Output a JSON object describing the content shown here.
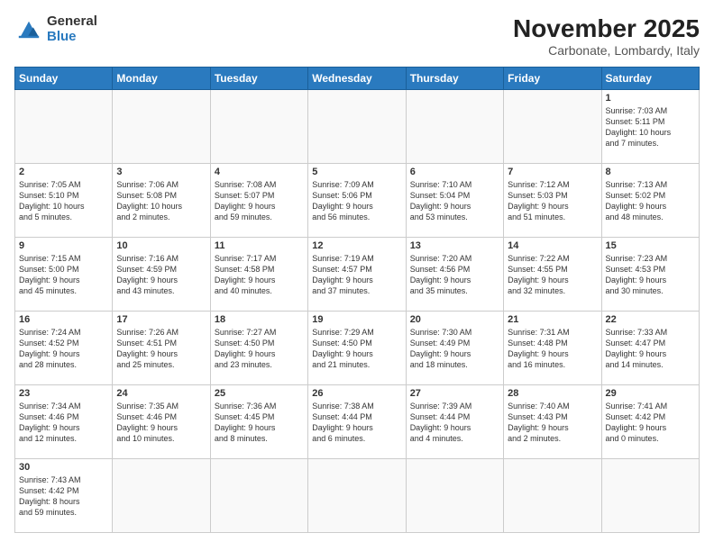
{
  "header": {
    "logo_general": "General",
    "logo_blue": "Blue",
    "month": "November 2025",
    "location": "Carbonate, Lombardy, Italy"
  },
  "weekdays": [
    "Sunday",
    "Monday",
    "Tuesday",
    "Wednesday",
    "Thursday",
    "Friday",
    "Saturday"
  ],
  "weeks": [
    [
      {
        "day": "",
        "content": ""
      },
      {
        "day": "",
        "content": ""
      },
      {
        "day": "",
        "content": ""
      },
      {
        "day": "",
        "content": ""
      },
      {
        "day": "",
        "content": ""
      },
      {
        "day": "",
        "content": ""
      },
      {
        "day": "1",
        "content": "Sunrise: 7:03 AM\nSunset: 5:11 PM\nDaylight: 10 hours\nand 7 minutes."
      }
    ],
    [
      {
        "day": "2",
        "content": "Sunrise: 7:05 AM\nSunset: 5:10 PM\nDaylight: 10 hours\nand 5 minutes."
      },
      {
        "day": "3",
        "content": "Sunrise: 7:06 AM\nSunset: 5:08 PM\nDaylight: 10 hours\nand 2 minutes."
      },
      {
        "day": "4",
        "content": "Sunrise: 7:08 AM\nSunset: 5:07 PM\nDaylight: 9 hours\nand 59 minutes."
      },
      {
        "day": "5",
        "content": "Sunrise: 7:09 AM\nSunset: 5:06 PM\nDaylight: 9 hours\nand 56 minutes."
      },
      {
        "day": "6",
        "content": "Sunrise: 7:10 AM\nSunset: 5:04 PM\nDaylight: 9 hours\nand 53 minutes."
      },
      {
        "day": "7",
        "content": "Sunrise: 7:12 AM\nSunset: 5:03 PM\nDaylight: 9 hours\nand 51 minutes."
      },
      {
        "day": "8",
        "content": "Sunrise: 7:13 AM\nSunset: 5:02 PM\nDaylight: 9 hours\nand 48 minutes."
      }
    ],
    [
      {
        "day": "9",
        "content": "Sunrise: 7:15 AM\nSunset: 5:00 PM\nDaylight: 9 hours\nand 45 minutes."
      },
      {
        "day": "10",
        "content": "Sunrise: 7:16 AM\nSunset: 4:59 PM\nDaylight: 9 hours\nand 43 minutes."
      },
      {
        "day": "11",
        "content": "Sunrise: 7:17 AM\nSunset: 4:58 PM\nDaylight: 9 hours\nand 40 minutes."
      },
      {
        "day": "12",
        "content": "Sunrise: 7:19 AM\nSunset: 4:57 PM\nDaylight: 9 hours\nand 37 minutes."
      },
      {
        "day": "13",
        "content": "Sunrise: 7:20 AM\nSunset: 4:56 PM\nDaylight: 9 hours\nand 35 minutes."
      },
      {
        "day": "14",
        "content": "Sunrise: 7:22 AM\nSunset: 4:55 PM\nDaylight: 9 hours\nand 32 minutes."
      },
      {
        "day": "15",
        "content": "Sunrise: 7:23 AM\nSunset: 4:53 PM\nDaylight: 9 hours\nand 30 minutes."
      }
    ],
    [
      {
        "day": "16",
        "content": "Sunrise: 7:24 AM\nSunset: 4:52 PM\nDaylight: 9 hours\nand 28 minutes."
      },
      {
        "day": "17",
        "content": "Sunrise: 7:26 AM\nSunset: 4:51 PM\nDaylight: 9 hours\nand 25 minutes."
      },
      {
        "day": "18",
        "content": "Sunrise: 7:27 AM\nSunset: 4:50 PM\nDaylight: 9 hours\nand 23 minutes."
      },
      {
        "day": "19",
        "content": "Sunrise: 7:29 AM\nSunset: 4:50 PM\nDaylight: 9 hours\nand 21 minutes."
      },
      {
        "day": "20",
        "content": "Sunrise: 7:30 AM\nSunset: 4:49 PM\nDaylight: 9 hours\nand 18 minutes."
      },
      {
        "day": "21",
        "content": "Sunrise: 7:31 AM\nSunset: 4:48 PM\nDaylight: 9 hours\nand 16 minutes."
      },
      {
        "day": "22",
        "content": "Sunrise: 7:33 AM\nSunset: 4:47 PM\nDaylight: 9 hours\nand 14 minutes."
      }
    ],
    [
      {
        "day": "23",
        "content": "Sunrise: 7:34 AM\nSunset: 4:46 PM\nDaylight: 9 hours\nand 12 minutes."
      },
      {
        "day": "24",
        "content": "Sunrise: 7:35 AM\nSunset: 4:46 PM\nDaylight: 9 hours\nand 10 minutes."
      },
      {
        "day": "25",
        "content": "Sunrise: 7:36 AM\nSunset: 4:45 PM\nDaylight: 9 hours\nand 8 minutes."
      },
      {
        "day": "26",
        "content": "Sunrise: 7:38 AM\nSunset: 4:44 PM\nDaylight: 9 hours\nand 6 minutes."
      },
      {
        "day": "27",
        "content": "Sunrise: 7:39 AM\nSunset: 4:44 PM\nDaylight: 9 hours\nand 4 minutes."
      },
      {
        "day": "28",
        "content": "Sunrise: 7:40 AM\nSunset: 4:43 PM\nDaylight: 9 hours\nand 2 minutes."
      },
      {
        "day": "29",
        "content": "Sunrise: 7:41 AM\nSunset: 4:42 PM\nDaylight: 9 hours\nand 0 minutes."
      }
    ],
    [
      {
        "day": "30",
        "content": "Sunrise: 7:43 AM\nSunset: 4:42 PM\nDaylight: 8 hours\nand 59 minutes."
      },
      {
        "day": "",
        "content": ""
      },
      {
        "day": "",
        "content": ""
      },
      {
        "day": "",
        "content": ""
      },
      {
        "day": "",
        "content": ""
      },
      {
        "day": "",
        "content": ""
      },
      {
        "day": "",
        "content": ""
      }
    ]
  ]
}
